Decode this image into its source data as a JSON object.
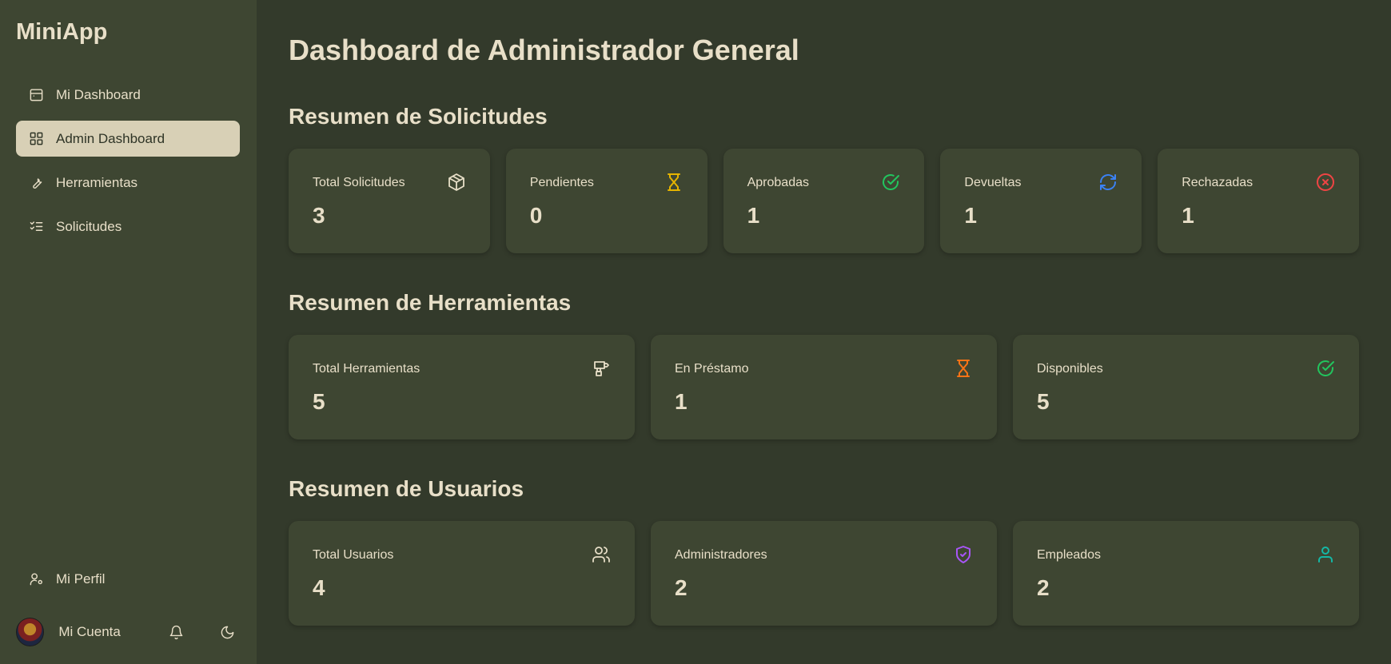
{
  "app": {
    "brand": "MiniApp"
  },
  "sidebar": {
    "items": [
      {
        "label": "Mi Dashboard",
        "icon": "calendar-icon",
        "active": false
      },
      {
        "label": "Admin Dashboard",
        "icon": "layout-grid-icon",
        "active": true
      },
      {
        "label": "Herramientas",
        "icon": "wrench-icon",
        "active": false
      },
      {
        "label": "Solicitudes",
        "icon": "list-checks-icon",
        "active": false
      }
    ],
    "profile_label": "Mi Perfil",
    "account_name": "Mi Cuenta"
  },
  "main": {
    "title": "Dashboard de Administrador General",
    "solicitudes": {
      "title": "Resumen de Solicitudes",
      "cards": [
        {
          "label": "Total Solicitudes",
          "value": "3",
          "icon": "package-icon",
          "color": "#e8dfc8"
        },
        {
          "label": "Pendientes",
          "value": "0",
          "icon": "hourglass-icon",
          "color": "#e6b400"
        },
        {
          "label": "Aprobadas",
          "value": "1",
          "icon": "check-circle-icon",
          "color": "#22c55e"
        },
        {
          "label": "Devueltas",
          "value": "1",
          "icon": "refresh-icon",
          "color": "#3b82f6"
        },
        {
          "label": "Rechazadas",
          "value": "1",
          "icon": "x-circle-icon",
          "color": "#ef4444"
        }
      ]
    },
    "herramientas": {
      "title": "Resumen de Herramientas",
      "cards": [
        {
          "label": "Total Herramientas",
          "value": "5",
          "icon": "drill-icon",
          "color": "#e8dfc8"
        },
        {
          "label": "En Préstamo",
          "value": "1",
          "icon": "hourglass-icon",
          "color": "#f97316"
        },
        {
          "label": "Disponibles",
          "value": "5",
          "icon": "check-circle-icon",
          "color": "#22c55e"
        }
      ]
    },
    "usuarios": {
      "title": "Resumen de Usuarios",
      "cards": [
        {
          "label": "Total Usuarios",
          "value": "4",
          "icon": "users-icon",
          "color": "#e8dfc8"
        },
        {
          "label": "Administradores",
          "value": "2",
          "icon": "shield-check-icon",
          "color": "#a855f7"
        },
        {
          "label": "Empleados",
          "value": "2",
          "icon": "user-icon",
          "color": "#14b8a6"
        }
      ]
    }
  }
}
